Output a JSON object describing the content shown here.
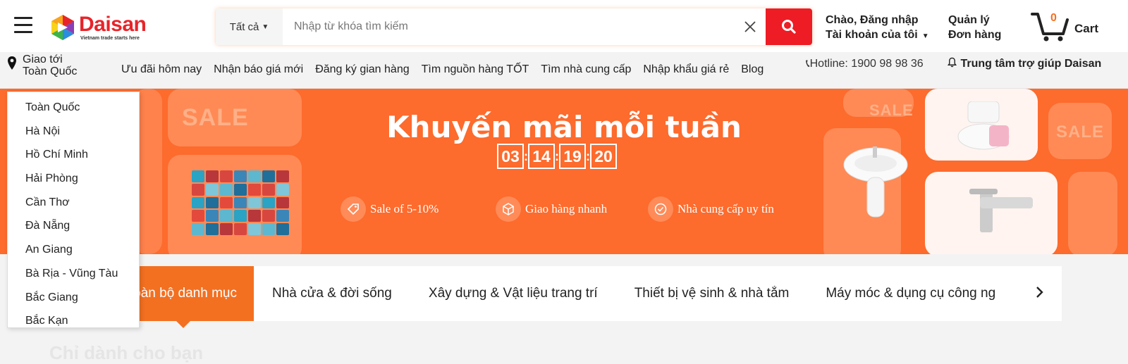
{
  "header": {
    "logo_name": "Daisan",
    "logo_tagline": "Vietnam trade starts here",
    "search": {
      "category": "Tất cả",
      "placeholder": "Nhập từ khóa tìm kiếm"
    },
    "account_line1": "Chào, Đăng nhập",
    "account_line2": "Tài khoản của tôi",
    "orders_line1": "Quản lý",
    "orders_line2": "Đơn hàng",
    "cart_count": "0",
    "cart_label": "Cart"
  },
  "navbar": {
    "deliver_to": "Giao tới Toàn Quốc",
    "links": [
      "Ưu đãi hôm nay",
      "Nhận báo giá mới",
      "Đăng ký gian hàng",
      "Tìm nguồn hàng TỐT",
      "Tìm nhà cung cấp",
      "Nhập khẩu giá rẻ",
      "Blog"
    ],
    "hotline": "Hotline: 1900 98 98 36",
    "help": "Trung tâm trợ giúp Daisan"
  },
  "banner": {
    "title": "Khuyến mãi mỗi tuần",
    "sale_word": "SALE",
    "countdown": [
      "03",
      "14",
      "19",
      "20"
    ],
    "features": [
      "Sale of 5-10%",
      "Giao hàng nhanh",
      "Nhà cung cấp uy tín"
    ]
  },
  "categories": {
    "active": "Toàn bộ danh mục",
    "items": [
      "Nhà cửa & đời sống",
      "Xây dựng & Vật liệu trang trí",
      "Thiết bị vệ sinh & nhà tắm",
      "Máy móc & dụng cụ công ng"
    ]
  },
  "section_title": "Chỉ dành cho bạn",
  "dropdown": {
    "items": [
      "Toàn Quốc",
      "Hà Nội",
      "Hồ Chí Minh",
      "Hải Phòng",
      "Cần Thơ",
      "Đà Nẵng",
      "An Giang",
      "Bà Rịa - Vũng Tàu",
      "Bắc Giang",
      "Bắc Kạn"
    ]
  },
  "colors": {
    "brand_red": "#ee1c25",
    "accent_orange": "#f37021",
    "banner_orange": "#fd6b2d"
  }
}
